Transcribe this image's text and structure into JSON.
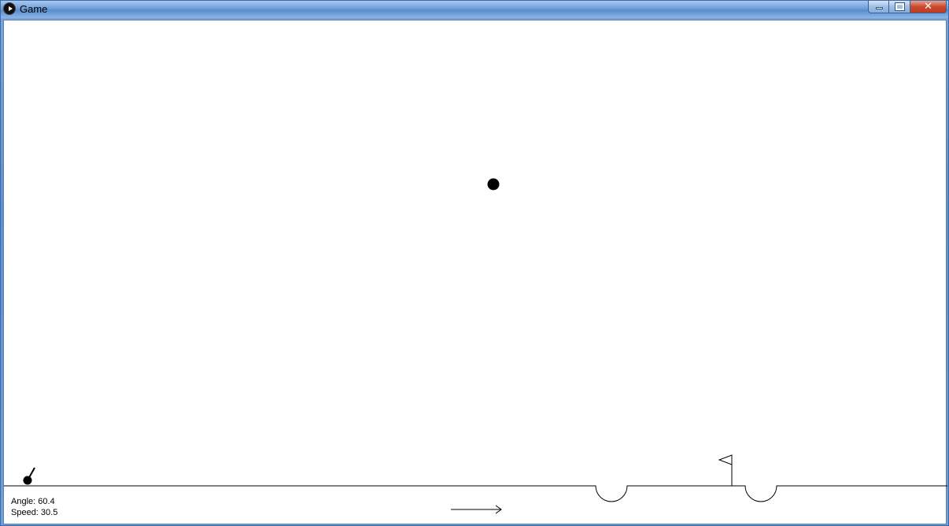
{
  "window": {
    "title": "Game",
    "icon": "play-icon",
    "controls": {
      "minimize": "minimize-icon",
      "maximize": "maximize-icon",
      "close": "close-icon",
      "close_glyph": "✕"
    }
  },
  "hud": {
    "angle_label": "Angle: 60.4",
    "speed_label": "Speed: 30.5"
  },
  "game": {
    "launch_angle_deg": 60.4,
    "speed": 30.5,
    "ball_color": "#000000",
    "ground_color": "#000000"
  }
}
